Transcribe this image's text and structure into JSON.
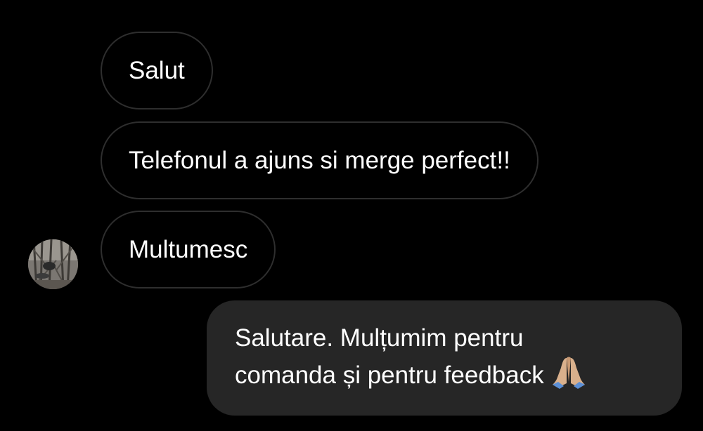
{
  "conversation": {
    "incoming": [
      {
        "text": "Salut"
      },
      {
        "text": "Telefonul a ajuns si merge perfect!!"
      },
      {
        "text": "Multumesc"
      }
    ],
    "outgoing": {
      "line1": "Salutare. Mulțumim pentru",
      "line2": "comanda și pentru feedback",
      "emoji": "pray-icon"
    }
  },
  "avatar": {
    "icon": "user-avatar-photo"
  },
  "colors": {
    "background": "#000000",
    "incoming_border": "#2e2e2e",
    "outgoing_bubble": "#262626",
    "text": "#ffffff"
  }
}
